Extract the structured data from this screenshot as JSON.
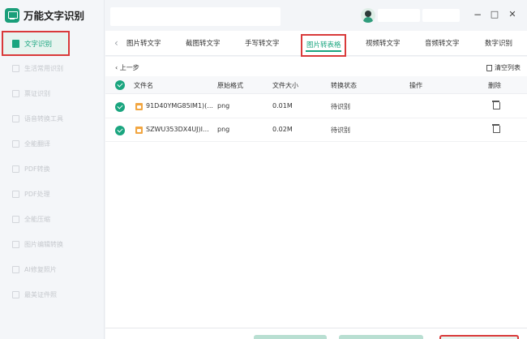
{
  "app": {
    "title": "万能文字识别"
  },
  "sidebar": {
    "items": [
      {
        "label": "文字识别",
        "active": true
      },
      {
        "label": "生活常用识别"
      },
      {
        "label": "票证识别"
      },
      {
        "label": "语音转换工具"
      },
      {
        "label": "全能翻译"
      },
      {
        "label": "PDF转换"
      },
      {
        "label": "PDF处理"
      },
      {
        "label": "全能压缩"
      },
      {
        "label": "图片编辑转换"
      },
      {
        "label": "AI修复照片"
      },
      {
        "label": "最美证件照"
      }
    ]
  },
  "window": {
    "minimize": "−",
    "maximize": "□",
    "close": "✕"
  },
  "tabs": [
    {
      "label": "图片转文字"
    },
    {
      "label": "截图转文字"
    },
    {
      "label": "手写转文字"
    },
    {
      "label": "图片转表格",
      "active": true
    },
    {
      "label": "视频转文字"
    },
    {
      "label": "音频转文字"
    },
    {
      "label": "数字识别"
    }
  ],
  "toolbar": {
    "back_label": "上一步",
    "clear_label": "清空列表"
  },
  "table": {
    "headers": [
      "文件名",
      "原始格式",
      "文件大小",
      "转换状态",
      "操作",
      "删除"
    ],
    "rows": [
      {
        "name": "91D40YMG85IM1)(...",
        "format": "png",
        "size": "0.01M",
        "status": "待识别"
      },
      {
        "name": "SZWU353DX4UJ)I...",
        "format": "png",
        "size": "0.02M",
        "status": "待识别"
      }
    ]
  },
  "colors": {
    "accent": "#1aa57f",
    "highlight_box": "#d93a3a",
    "file_icon": "#f2a641"
  }
}
